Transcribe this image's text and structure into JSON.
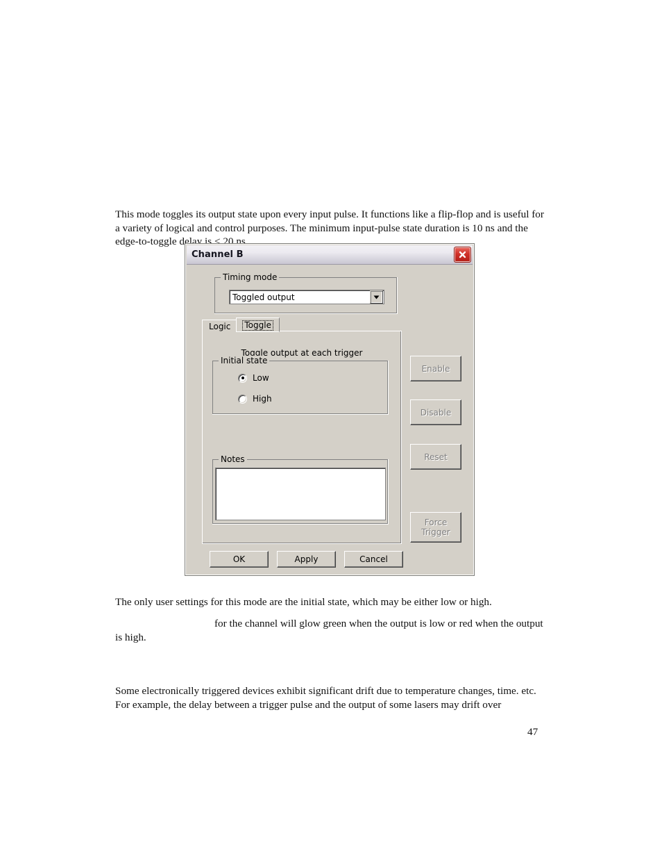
{
  "document": {
    "page_number": "47",
    "paragraphs": {
      "intro": "This mode toggles its output state upon every input pulse. It functions like a flip-flop and is useful for a variety of logical and control purposes. The minimum input-pulse state duration is 10 ns and the edge-to-toggle delay is < 20 ns.",
      "usage": "The only user settings for this mode are the initial state, which may be either low or high.",
      "glow": "for the channel will glow green when the output is low or red when the output is high.",
      "drift": "Some electronically triggered devices exhibit significant drift due to temperature changes, time. etc.   For example, the delay between a trigger pulse and the output of some lasers may drift over"
    }
  },
  "dialog": {
    "title": "Channel B",
    "close_label": "Close",
    "timing_mode": {
      "group_label": "Timing mode",
      "selected": "Toggled output",
      "options": [
        "Toggled output"
      ]
    },
    "tabs": [
      {
        "label": "Logic",
        "active": false
      },
      {
        "label": "Toggle",
        "active": true
      }
    ],
    "toggle_panel": {
      "caption": "Toggle output at each trigger",
      "initial_state": {
        "group_label": "Initial state",
        "options": [
          {
            "label": "Low",
            "selected": true
          },
          {
            "label": "High",
            "selected": false
          }
        ]
      },
      "notes": {
        "group_label": "Notes",
        "value": "",
        "placeholder": ""
      }
    },
    "action_buttons": [
      {
        "label": "Enable",
        "enabled": false
      },
      {
        "label": "Disable",
        "enabled": false
      },
      {
        "label": "Reset",
        "enabled": false
      },
      {
        "label": "Force Trigger",
        "line1": "Force",
        "line2": "Trigger",
        "enabled": false
      }
    ],
    "footer_buttons": [
      {
        "label": "OK",
        "enabled": true
      },
      {
        "label": "Apply",
        "enabled": true
      },
      {
        "label": "Cancel",
        "enabled": true
      }
    ],
    "colors": {
      "dialog_face": "#d4d0c8",
      "close_button": "#d0322a",
      "titlebar_top": "#f2f1f5",
      "titlebar_bottom": "#c9c6d2",
      "disabled_text": "#808080"
    }
  }
}
